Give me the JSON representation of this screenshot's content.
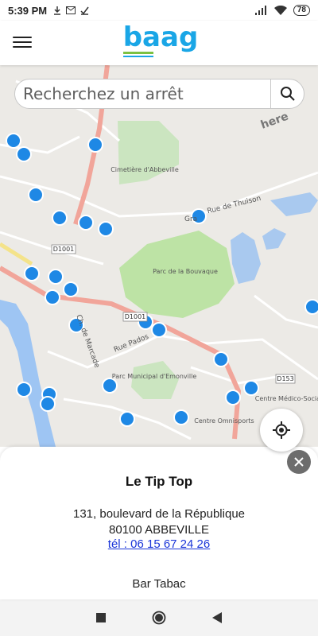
{
  "status_bar": {
    "time": "5:39 PM",
    "notification_icons": [
      "download-icon",
      "gmail-icon",
      "check-icon"
    ],
    "signal_icon": "signal-icon",
    "wifi_icon": "wifi-icon",
    "battery_level": "78"
  },
  "app": {
    "menu_icon": "hamburger-menu-icon",
    "logo_text": "baag",
    "brand_color": "#1aa6e6",
    "logo_accent_color": "#7cc142"
  },
  "search": {
    "placeholder": "Recherchez un arrêt",
    "button_icon": "search-icon"
  },
  "map": {
    "provider_mark": "here",
    "stop_icon": "bus-stop-icon",
    "labels": {
      "cimetiere": "Cimetière d'Abbeville",
      "parc_bouvaque": "Parc de la Bouvaque",
      "parc_emonville": "Parc Municipal d'Emonville",
      "rue_thuison": "Rue de Thuison",
      "rue_pados": "Rue Pados",
      "rue_marcade": "Ch. de Marcade",
      "d1001": "D1001",
      "d1001b": "D1001",
      "d153": "D153",
      "centre_medico": "Centre Médico-Social",
      "centre_omnisports": "Centre Omnisports",
      "road_gra": "Gra"
    }
  },
  "locate_button_icon": "locate-icon",
  "close_button_icon": "close-icon",
  "stop_card": {
    "name": "Le Tip Top",
    "address_line1": "131, boulevard de la République",
    "address_line2": "80100 ABBEVILLE",
    "phone": "tél : 06 15 67 24 26",
    "category": "Bar Tabac"
  },
  "nav_bar": {
    "buttons": [
      "recents-button",
      "home-button",
      "back-button"
    ]
  }
}
